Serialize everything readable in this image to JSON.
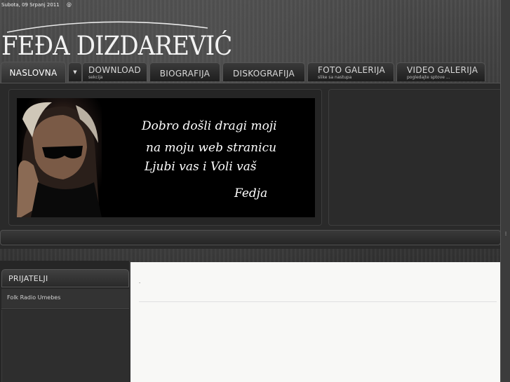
{
  "header": {
    "date": "Subota, 09 Srpanj 2011",
    "date_icon": "@",
    "logo": "FEĐA DIZDAREVIĆ"
  },
  "nav": {
    "tabs": [
      {
        "label": "NASLOVNA",
        "sub": "",
        "active": true
      },
      {
        "label": "",
        "icon": "chevron-down-icon"
      },
      {
        "label": "DOWNLOAD",
        "sub": "sekcija"
      },
      {
        "label": "BIOGRAFIJA",
        "sub": ""
      },
      {
        "label": "DISKOGRAFIJA",
        "sub": ""
      },
      {
        "label": "FOTO GALERIJA",
        "sub": "slike sa nastupa"
      },
      {
        "label": "VIDEO GALERIJA",
        "sub": "pogledajte sptove ..."
      }
    ],
    "dropdown_glyph": "▼"
  },
  "banner": {
    "line1": "Dobro došli dragi moji",
    "line2": "na moju web stranicu",
    "line3": "Ljubi vas i Voli vaš",
    "signature": "Fedja"
  },
  "sidebar": {
    "heading": "PRIJATELJI",
    "items": [
      {
        "label": "Folk Radio Umebes"
      }
    ]
  },
  "content": {
    "marker": "."
  },
  "scrollbar": {
    "thumb_glyph": "⁞"
  },
  "colors": {
    "background": "#2a2a2a",
    "content_bg": "#f8f8f6",
    "text_light": "#f2f2f2"
  }
}
